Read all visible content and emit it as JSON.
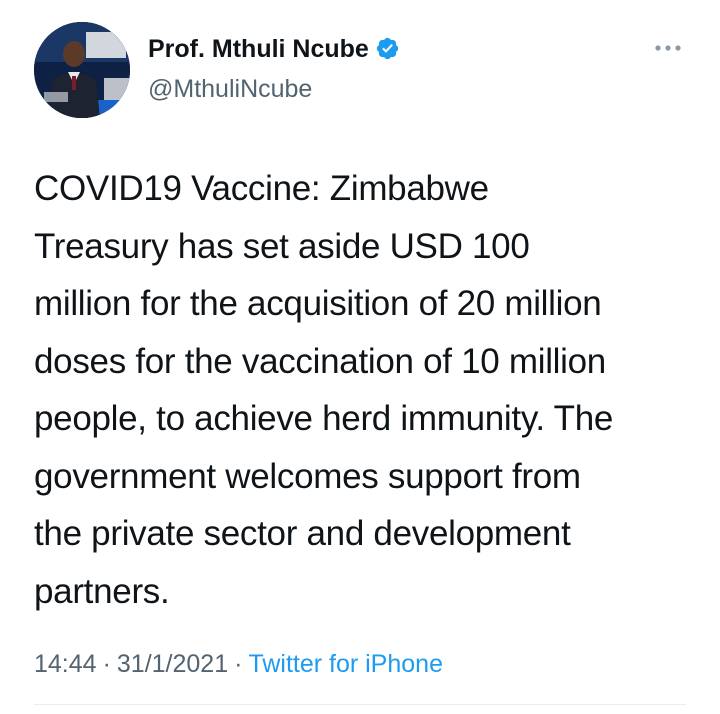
{
  "author": {
    "display_name": "Prof. Mthuli Ncube",
    "handle": "@MthuliNcube",
    "verified": true,
    "avatar_icon": "profile-photo",
    "verified_icon": "verified-badge-icon"
  },
  "menu": {
    "icon": "more-options-icon"
  },
  "tweet": {
    "lines": [
      "COVID19 Vaccine: Zimbabwe",
      "Treasury has set aside USD 100",
      "million for the acquisition of 20 million",
      "doses for the vaccination of 10 million",
      "people, to achieve herd immunity. The",
      "government welcomes support from",
      "the private sector and development",
      "partners."
    ]
  },
  "meta": {
    "time": "14:44",
    "separator": "·",
    "date": "31/1/2021",
    "source": "Twitter for iPhone"
  },
  "colors": {
    "text": "#0f1419",
    "secondary": "#536471",
    "accent": "#1d9bf0"
  }
}
